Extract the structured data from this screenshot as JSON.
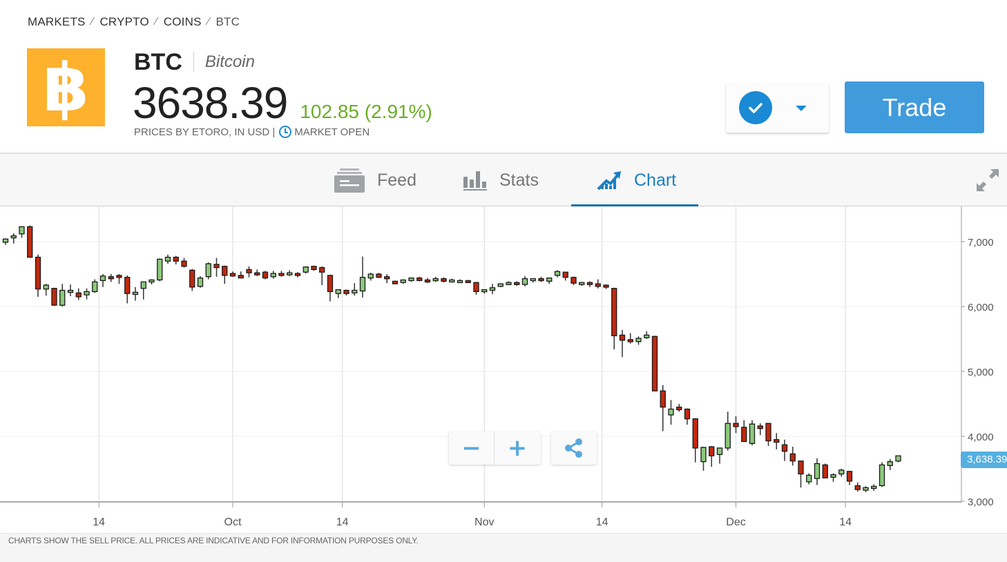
{
  "breadcrumb": [
    {
      "label": "MARKETS"
    },
    {
      "label": "CRYPTO"
    },
    {
      "label": "COINS"
    },
    {
      "label": "BTC"
    }
  ],
  "instrument": {
    "logo_glyph": "฿",
    "logo_color": "#fdb12c",
    "symbol": "BTC",
    "name": "Bitcoin",
    "price": "3638.39",
    "change": "102.85 (2.91%)",
    "change_color": "#6cad26",
    "source_note": "PRICES BY ETORO, IN USD |",
    "market_status": "MARKET OPEN"
  },
  "actions": {
    "watchlist_icon": "check-circle-icon",
    "dropdown_icon": "caret-down-icon",
    "trade_label": "Trade",
    "accent": "#409bdc"
  },
  "tabs": [
    {
      "label": "Feed",
      "icon": "feed-icon",
      "active": false
    },
    {
      "label": "Stats",
      "icon": "bar-stats-icon",
      "active": false
    },
    {
      "label": "Chart",
      "icon": "trend-chart-icon",
      "active": true
    }
  ],
  "chart_controls": {
    "zoom_out": "−",
    "zoom_in": "+",
    "share_icon": "share-icon",
    "expand_icon": "expand-icon"
  },
  "footer": {
    "disclaimer": "CHARTS SHOW THE SELL PRICE. ALL PRICES ARE INDICATIVE AND FOR INFORMATION PURPOSES ONLY."
  },
  "chart_data": {
    "type": "candlestick",
    "title": "",
    "xlabel": "",
    "ylabel": "",
    "ylim": [
      2760,
      7450
    ],
    "y_ticks": [
      3000,
      4000,
      5000,
      6000,
      7000
    ],
    "y_tick_labels": [
      "3,000",
      "4,000",
      "5,000",
      "6,000",
      "7,000"
    ],
    "x_ticks": [
      {
        "label": "14",
        "index": 11.5
      },
      {
        "label": "Oct",
        "index": 28
      },
      {
        "label": "14",
        "index": 41.5
      },
      {
        "label": "Nov",
        "index": 59
      },
      {
        "label": "14",
        "index": 73.5
      },
      {
        "label": "Dec",
        "index": 90
      },
      {
        "label": "14",
        "index": 103.5
      }
    ],
    "grid": true,
    "current_price_label": "3,638.39",
    "current_price": 3638.39,
    "up_color": "#8cc97c",
    "down_color": "#c1290e",
    "candles": [
      [
        6990,
        7050,
        6950,
        7040
      ],
      [
        7060,
        7130,
        6970,
        7090
      ],
      [
        7120,
        7200,
        7060,
        7230
      ],
      [
        7230,
        7250,
        6750,
        6760
      ],
      [
        6760,
        6800,
        6150,
        6270
      ],
      [
        6270,
        6350,
        6170,
        6330
      ],
      [
        6280,
        6290,
        6090,
        6020
      ],
      [
        6020,
        6350,
        6000,
        6250
      ],
      [
        6250,
        6340,
        6160,
        6250
      ],
      [
        6210,
        6280,
        6100,
        6150
      ],
      [
        6180,
        6280,
        6110,
        6230
      ],
      [
        6230,
        6420,
        6210,
        6380
      ],
      [
        6400,
        6500,
        6300,
        6470
      ],
      [
        6460,
        6500,
        6380,
        6440
      ],
      [
        6480,
        6500,
        6350,
        6460
      ],
      [
        6450,
        6480,
        6050,
        6200
      ],
      [
        6200,
        6300,
        6090,
        6220
      ],
      [
        6280,
        6370,
        6110,
        6380
      ],
      [
        6390,
        6420,
        6340,
        6410
      ],
      [
        6410,
        6740,
        6390,
        6730
      ],
      [
        6700,
        6800,
        6660,
        6760
      ],
      [
        6760,
        6780,
        6650,
        6700
      ],
      [
        6700,
        6750,
        6600,
        6620
      ],
      [
        6560,
        6580,
        6240,
        6300
      ],
      [
        6310,
        6470,
        6290,
        6440
      ],
      [
        6460,
        6680,
        6420,
        6660
      ],
      [
        6650,
        6750,
        6460,
        6600
      ],
      [
        6620,
        6630,
        6350,
        6480
      ],
      [
        6510,
        6540,
        6460,
        6470
      ],
      [
        6480,
        6540,
        6460,
        6440
      ],
      [
        6570,
        6620,
        6450,
        6520
      ],
      [
        6520,
        6570,
        6470,
        6500
      ],
      [
        6530,
        6550,
        6420,
        6440
      ],
      [
        6460,
        6550,
        6430,
        6510
      ],
      [
        6510,
        6550,
        6460,
        6480
      ],
      [
        6500,
        6560,
        6470,
        6520
      ],
      [
        6510,
        6530,
        6450,
        6490
      ],
      [
        6530,
        6620,
        6510,
        6610
      ],
      [
        6620,
        6630,
        6550,
        6570
      ],
      [
        6600,
        6620,
        6330,
        6530
      ],
      [
        6480,
        6490,
        6080,
        6230
      ],
      [
        6200,
        6250,
        6130,
        6260
      ],
      [
        6250,
        6260,
        6170,
        6200
      ],
      [
        6210,
        6360,
        6170,
        6250
      ],
      [
        6240,
        6770,
        6140,
        6450
      ],
      [
        6440,
        6520,
        6400,
        6500
      ],
      [
        6500,
        6520,
        6440,
        6450
      ],
      [
        6460,
        6500,
        6360,
        6430
      ],
      [
        6390,
        6400,
        6350,
        6350
      ],
      [
        6370,
        6410,
        6350,
        6410
      ],
      [
        6400,
        6450,
        6380,
        6440
      ],
      [
        6440,
        6460,
        6390,
        6400
      ],
      [
        6410,
        6440,
        6360,
        6380
      ],
      [
        6400,
        6460,
        6380,
        6430
      ],
      [
        6430,
        6450,
        6370,
        6390
      ],
      [
        6390,
        6430,
        6370,
        6410
      ],
      [
        6400,
        6420,
        6380,
        6400
      ],
      [
        6400,
        6410,
        6370,
        6370
      ],
      [
        6370,
        6380,
        6180,
        6230
      ],
      [
        6240,
        6260,
        6200,
        6260
      ],
      [
        6250,
        6350,
        6190,
        6290
      ],
      [
        6310,
        6360,
        6300,
        6350
      ],
      [
        6340,
        6390,
        6330,
        6370
      ],
      [
        6370,
        6390,
        6320,
        6350
      ],
      [
        6340,
        6470,
        6310,
        6430
      ],
      [
        6400,
        6420,
        6370,
        6430
      ],
      [
        6430,
        6460,
        6380,
        6400
      ],
      [
        6390,
        6430,
        6350,
        6440
      ],
      [
        6480,
        6560,
        6450,
        6540
      ],
      [
        6530,
        6530,
        6400,
        6450
      ],
      [
        6450,
        6460,
        6330,
        6360
      ],
      [
        6340,
        6380,
        6320,
        6370
      ],
      [
        6370,
        6390,
        6300,
        6340
      ],
      [
        6350,
        6420,
        6280,
        6310
      ],
      [
        6330,
        6340,
        6270,
        6300
      ],
      [
        6280,
        6290,
        5340,
        5550
      ],
      [
        5560,
        5640,
        5220,
        5480
      ],
      [
        5490,
        5590,
        5430,
        5460
      ],
      [
        5460,
        5540,
        5410,
        5510
      ],
      [
        5520,
        5620,
        5500,
        5560
      ],
      [
        5540,
        5550,
        4730,
        4700
      ],
      [
        4700,
        4790,
        4080,
        4450
      ],
      [
        4330,
        4560,
        4180,
        4420
      ],
      [
        4450,
        4500,
        4380,
        4410
      ],
      [
        4420,
        4430,
        4180,
        4270
      ],
      [
        4270,
        4280,
        3600,
        3820
      ],
      [
        3610,
        3840,
        3470,
        3830
      ],
      [
        3840,
        3850,
        3530,
        3700
      ],
      [
        3720,
        3790,
        3580,
        3820
      ],
      [
        3820,
        4380,
        3780,
        4200
      ],
      [
        4200,
        4310,
        4050,
        4150
      ],
      [
        4140,
        4250,
        3940,
        3920
      ],
      [
        3890,
        4250,
        3860,
        4190
      ],
      [
        4160,
        4200,
        4020,
        4120
      ],
      [
        4200,
        4200,
        3850,
        3930
      ],
      [
        3950,
        4050,
        3800,
        3910
      ],
      [
        3870,
        3950,
        3620,
        3770
      ],
      [
        3730,
        3840,
        3550,
        3620
      ],
      [
        3620,
        3620,
        3210,
        3420
      ],
      [
        3300,
        3430,
        3260,
        3400
      ],
      [
        3350,
        3660,
        3250,
        3580
      ],
      [
        3560,
        3580,
        3400,
        3360
      ],
      [
        3370,
        3430,
        3300,
        3410
      ],
      [
        3420,
        3500,
        3380,
        3480
      ],
      [
        3460,
        3470,
        3250,
        3310
      ],
      [
        3240,
        3290,
        3150,
        3180
      ],
      [
        3170,
        3230,
        3140,
        3210
      ],
      [
        3210,
        3260,
        3160,
        3230
      ],
      [
        3240,
        3600,
        3220,
        3560
      ],
      [
        3550,
        3650,
        3480,
        3610
      ],
      [
        3620,
        3700,
        3600,
        3700
      ]
    ]
  }
}
